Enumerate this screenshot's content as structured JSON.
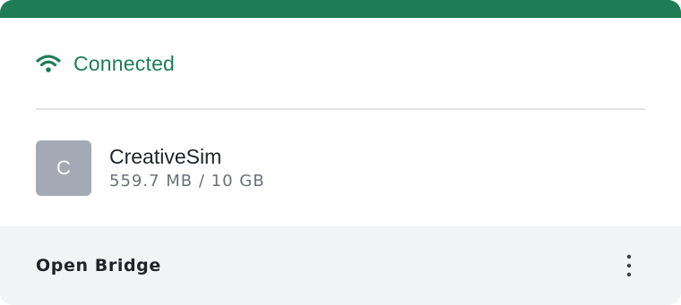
{
  "colors": {
    "accent": "#1e7d55",
    "avatar_bg": "#a5a8b5",
    "footer_bg": "#f2f3f5"
  },
  "status": {
    "icon": "wifi-icon",
    "label": "Connected"
  },
  "sim": {
    "avatar_letter": "C",
    "name": "CreativeSim",
    "usage": "559.7 MB / 10 GB"
  },
  "footer": {
    "action_label": "Open Bridge",
    "more_icon": "more-vertical-icon"
  }
}
